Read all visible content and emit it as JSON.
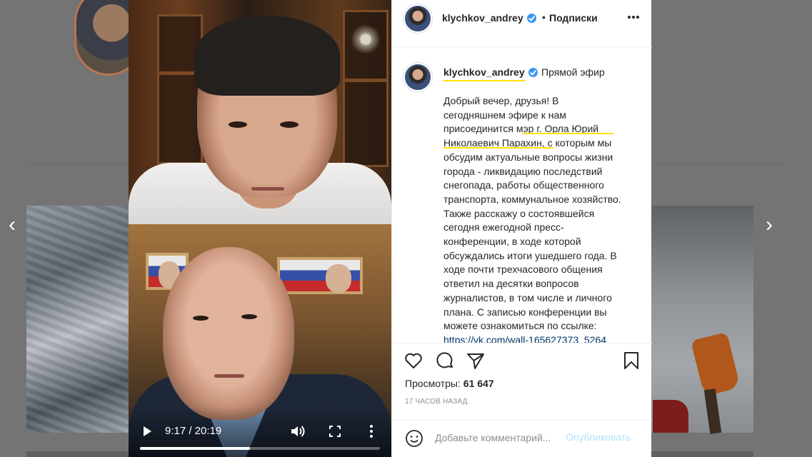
{
  "navigation": {
    "prev_arrow": "‹",
    "next_arrow": "›"
  },
  "video": {
    "current_time": "9:17",
    "duration": "20:19",
    "time_separator": " / ",
    "progress": 0.457
  },
  "post": {
    "header": {
      "username": "klychkov_andrey",
      "verified": true,
      "separator": "•",
      "follow_label": "Подписки"
    },
    "caption": {
      "username": "klychkov_andrey",
      "type_label": "Прямой эфир",
      "text_before_link": "Добрый вечер, друзья! В сегодняшнем эфире к нам присоединится мэр г. Орла Юрий Николаевич Парахин, с которым мы обсудим актуальные вопросы жизни города - ликвидацию последствий снегопада, работы общественного транспорта, коммунальное хозяйство. Также расскажу о состоявшейся сегодня ежегодной пресс-конференции, в ходе которой обсуждались итоги ушедшего года. В ходе почти трехчасового общения ответил на десятки вопросов журналистов, в том числе и личного плана. С записью конференции вы можете ознакомиться по ссылке: ",
      "link": "https://vk.com/wall-165627373_5264"
    },
    "views_label": "Просмотры:",
    "views_value": "61 647",
    "timestamp": "17 ЧАСОВ НАЗАД",
    "comment": {
      "placeholder": "Добавьте комментарий...",
      "publish_label": "Опубликовать"
    }
  },
  "colors": {
    "highlight": "#ffe100",
    "verified": "#3897f0",
    "publish_disabled": "#b2dffc",
    "link": "#00376b"
  },
  "icons": [
    "play-icon",
    "volume-icon",
    "fullscreen-icon",
    "more-vertical-icon",
    "heart-icon",
    "comment-icon",
    "share-icon",
    "bookmark-icon",
    "emoji-icon",
    "more-horizontal-icon",
    "verified-badge-icon"
  ]
}
